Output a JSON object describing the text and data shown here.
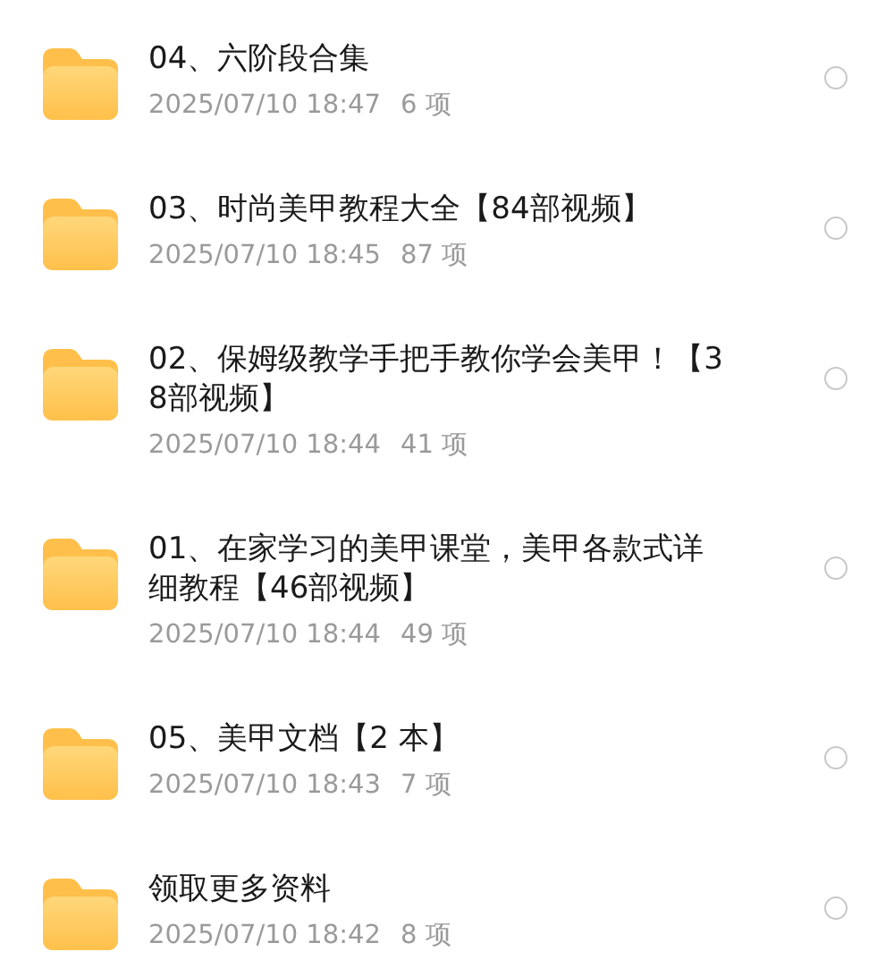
{
  "folders": [
    {
      "title_lines": [
        "04、六阶段合集"
      ],
      "date": "2025/07/10 18:47",
      "count": "6 项",
      "selected": false
    },
    {
      "title_lines": [
        "03、时尚美甲教程大全【84部视频】"
      ],
      "date": "2025/07/10 18:45",
      "count": "87 项",
      "selected": false
    },
    {
      "title_lines": [
        "02、保姆级教学手把手教你学会美甲！【3",
        "8部视频】"
      ],
      "date": "2025/07/10 18:44",
      "count": "41 项",
      "selected": false
    },
    {
      "title_lines": [
        "01、在家学习的美甲课堂，美甲各款式详",
        "细教程【46部视频】"
      ],
      "date": "2025/07/10 18:44",
      "count": "49 项",
      "selected": false
    },
    {
      "title_lines": [
        "05、美甲文档【2 本】"
      ],
      "date": "2025/07/10 18:43",
      "count": "7 项",
      "selected": false
    },
    {
      "title_lines": [
        "领取更多资料"
      ],
      "date": "2025/07/10 18:42",
      "count": "8 项",
      "selected": false
    }
  ]
}
